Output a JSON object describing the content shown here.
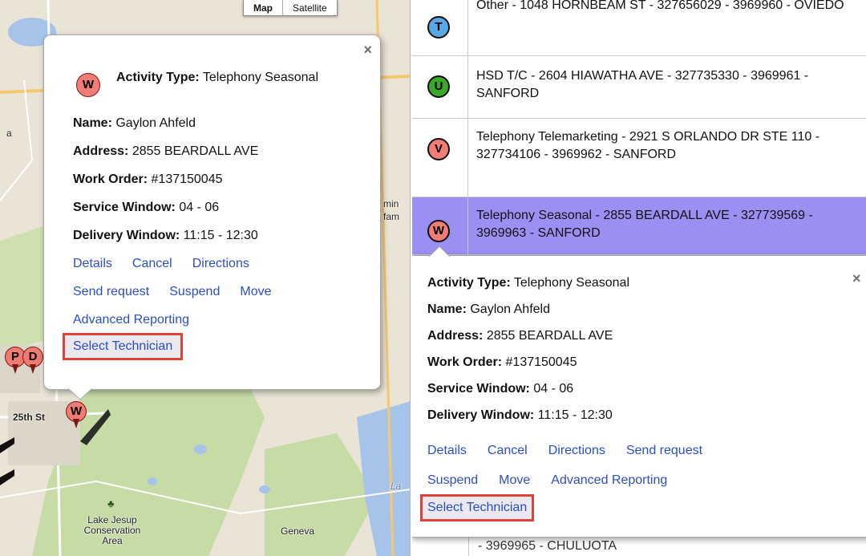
{
  "map": {
    "type_controls": [
      "Map",
      "Satellite"
    ],
    "labels": {
      "street": "25th St",
      "park": "Lake Jesup\nConservation\nArea",
      "town": "Geneva",
      "left_edge": "a",
      "mid1": "min",
      "mid2": "fam",
      "lake": "La"
    },
    "markers": [
      "P",
      "D",
      "W"
    ]
  },
  "map_popup": {
    "badge": "W",
    "close": "×",
    "activity_type_label": "Activity Type:",
    "activity_type_value": "Telephony Seasonal",
    "name_label": "Name:",
    "name_value": "Gaylon Ahfeld",
    "address_label": "Address:",
    "address_value": "2855 BEARDALL AVE",
    "work_order_label": "Work Order:",
    "work_order_value": "#137150045",
    "service_window_label": "Service Window:",
    "service_window_value": "04 - 06",
    "delivery_window_label": "Delivery Window:",
    "delivery_window_value": "11:15 - 12:30",
    "links": {
      "details": "Details",
      "cancel": "Cancel",
      "directions": "Directions",
      "send_request": "Send request",
      "suspend": "Suspend",
      "move": "Move",
      "advanced_reporting": "Advanced Reporting",
      "select_technician": "Select Technician"
    }
  },
  "list": {
    "items": [
      {
        "badge": "T",
        "badge_color": "#5aa7e6",
        "text": "Other - 1048 HORNBEAM ST - 327656029 - 3969960 - OVIEDO"
      },
      {
        "badge": "U",
        "badge_color": "#3aa82a",
        "text": "HSD T/C - 2604 HIAWATHA AVE - 327735330 - 3969961 - SANFORD"
      },
      {
        "badge": "V",
        "badge_color": "#f27c76",
        "text": "Telephony Telemarketing - 2921 S ORLANDO DR STE 110 - 327734106 - 3969962 - SANFORD"
      },
      {
        "badge": "W",
        "badge_color": "#f27c76",
        "text": "Telephony Seasonal - 2855 BEARDALL AVE - 327739569 - 3969963 - SANFORD"
      }
    ],
    "bottom_partial_text": "- 3969965 - CHULUOTA"
  },
  "list_popup": {
    "close": "×",
    "activity_type_label": "Activity Type:",
    "activity_type_value": "Telephony Seasonal",
    "name_label": "Name:",
    "name_value": "Gaylon Ahfeld",
    "address_label": "Address:",
    "address_value": "2855 BEARDALL AVE",
    "work_order_label": "Work Order:",
    "work_order_value": "#137150045",
    "service_window_label": "Service Window:",
    "service_window_value": "04 - 06",
    "delivery_window_label": "Delivery Window:",
    "delivery_window_value": "11:15 - 12:30",
    "links": {
      "details": "Details",
      "cancel": "Cancel",
      "directions": "Directions",
      "send_request": "Send request",
      "suspend": "Suspend",
      "move": "Move",
      "advanced_reporting": "Advanced Reporting",
      "select_technician": "Select Technician"
    }
  },
  "colors": {
    "selected_row": "#9b8ff2",
    "link": "#2b4ec4",
    "highlight_border": "#e0423a"
  }
}
